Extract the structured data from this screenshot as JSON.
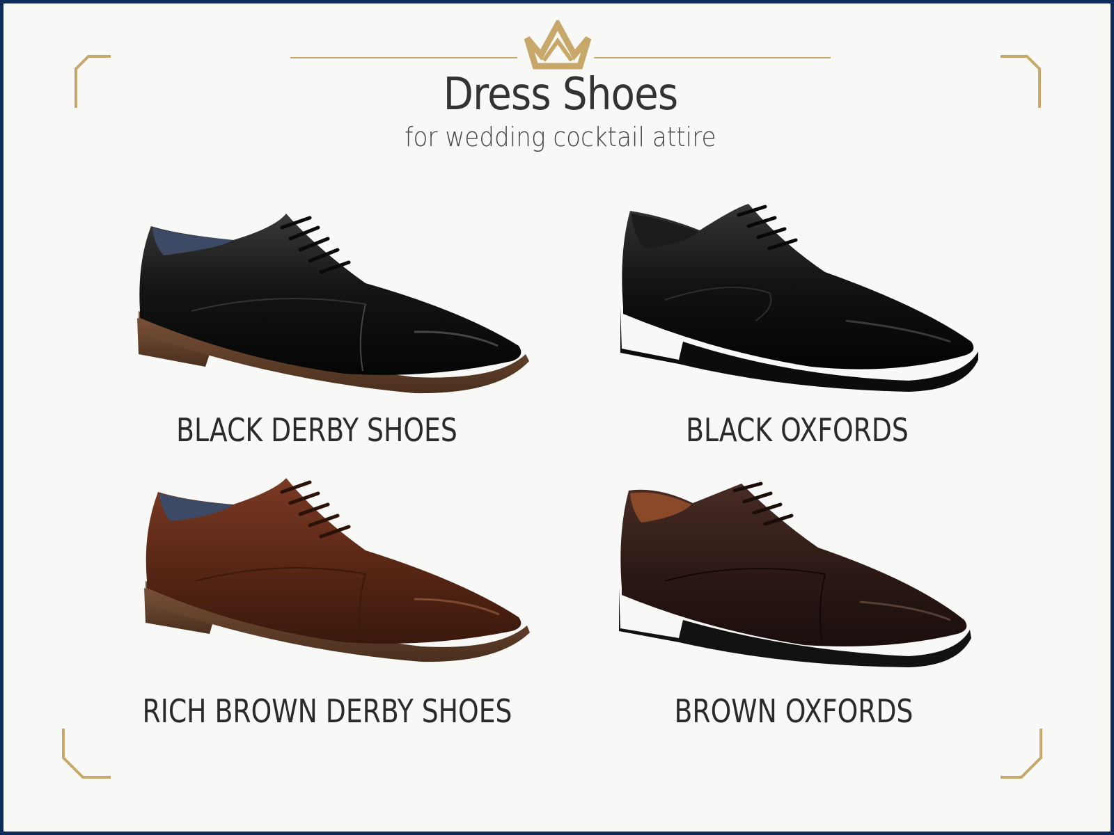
{
  "header": {
    "title": "Dress Shoes",
    "subtitle": "for wedding cocktail attire"
  },
  "colors": {
    "border": "#0f2b5b",
    "gold": "#c8a86a",
    "background": "#f8f8f6",
    "text": "#2a2a2a"
  },
  "shoes": [
    {
      "label": "BLACK DERBY SHOES",
      "color": "black",
      "icon": "black-cap-toe-shoe"
    },
    {
      "label": "BLACK OXFORDS",
      "color": "black",
      "icon": "black-plain-toe-shoe"
    },
    {
      "label": "RICH BROWN DERBY SHOES",
      "color": "brown",
      "icon": "brown-cap-toe-shoe"
    },
    {
      "label": "BROWN OXFORDS",
      "color": "dark-brown",
      "icon": "dark-brown-cap-toe-shoe"
    }
  ]
}
